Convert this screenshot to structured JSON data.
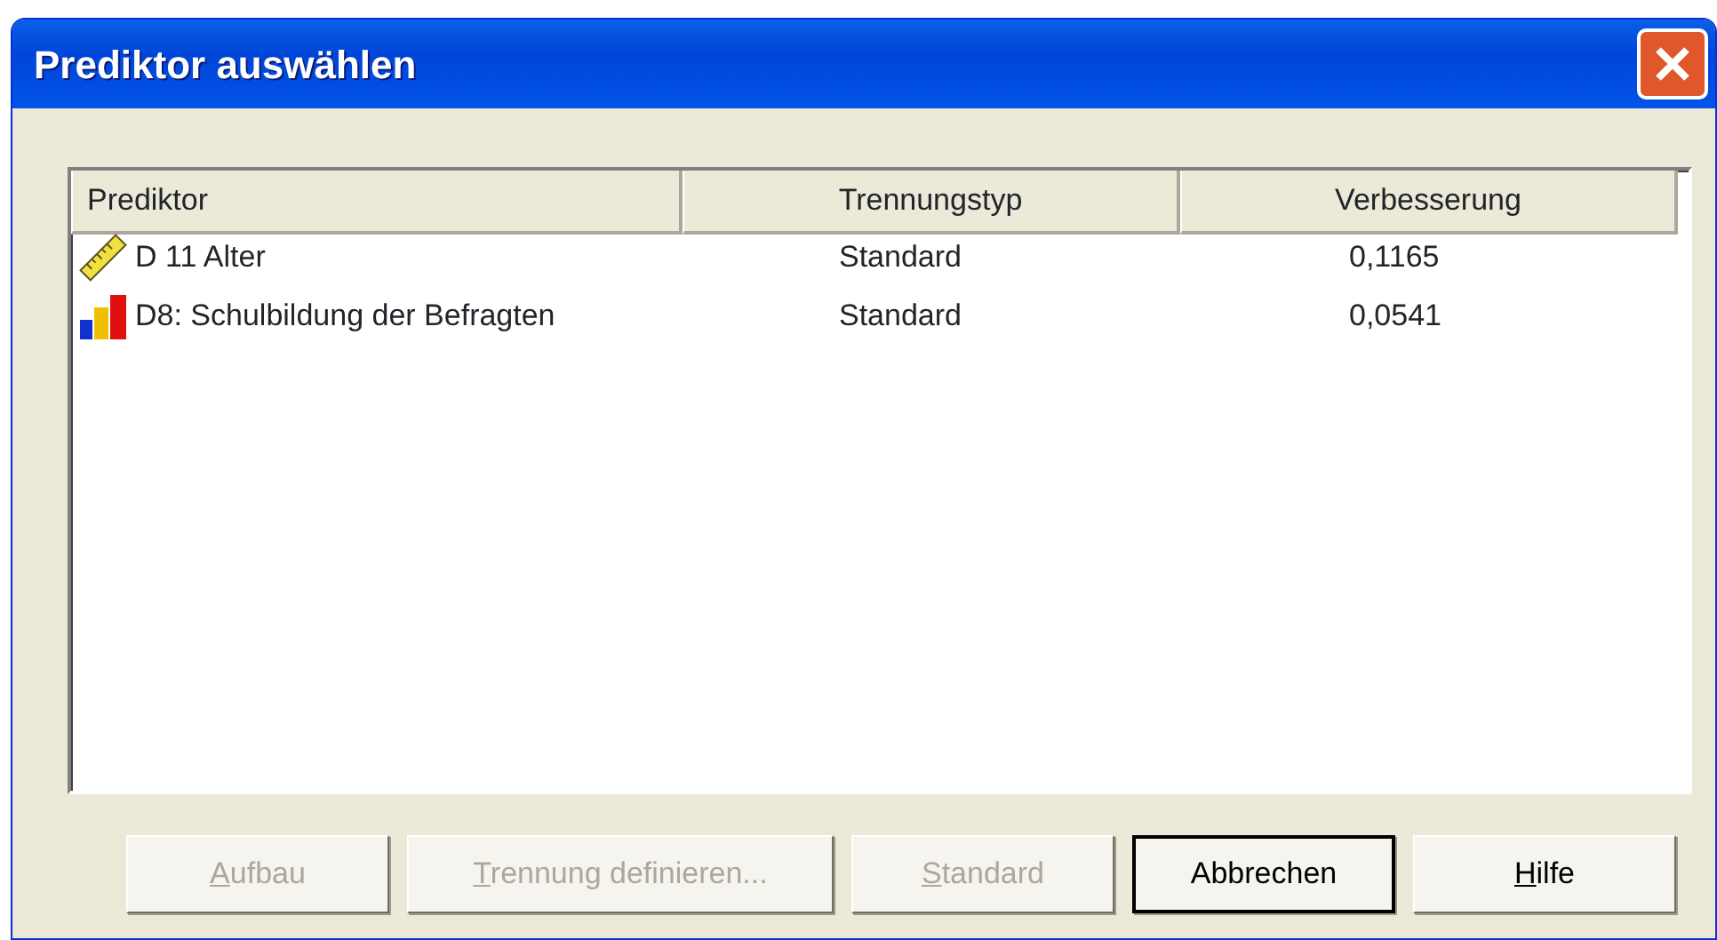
{
  "window": {
    "title": "Prediktor auswählen"
  },
  "table": {
    "columns": [
      "Prediktor",
      "Trennungstyp",
      "Verbesserung"
    ],
    "rows": [
      {
        "kind": "scale",
        "predictor": "D 11 Alter",
        "split_type": "Standard",
        "improvement": "0,1165"
      },
      {
        "kind": "ordinal",
        "predictor": "D8: Schulbildung der Befragten",
        "split_type": "Standard",
        "improvement": "0,0541"
      }
    ]
  },
  "buttons": [
    {
      "label": "Aufbau",
      "disabled": true,
      "default": false,
      "access_key": true
    },
    {
      "label": "Trennung definieren...",
      "disabled": true,
      "default": false,
      "access_key": true
    },
    {
      "label": "Standard",
      "disabled": true,
      "default": false,
      "access_key": true
    },
    {
      "label": "Abbrechen",
      "disabled": false,
      "default": true,
      "access_key": false
    },
    {
      "label": "Hilfe",
      "disabled": false,
      "default": false,
      "access_key": true
    }
  ]
}
